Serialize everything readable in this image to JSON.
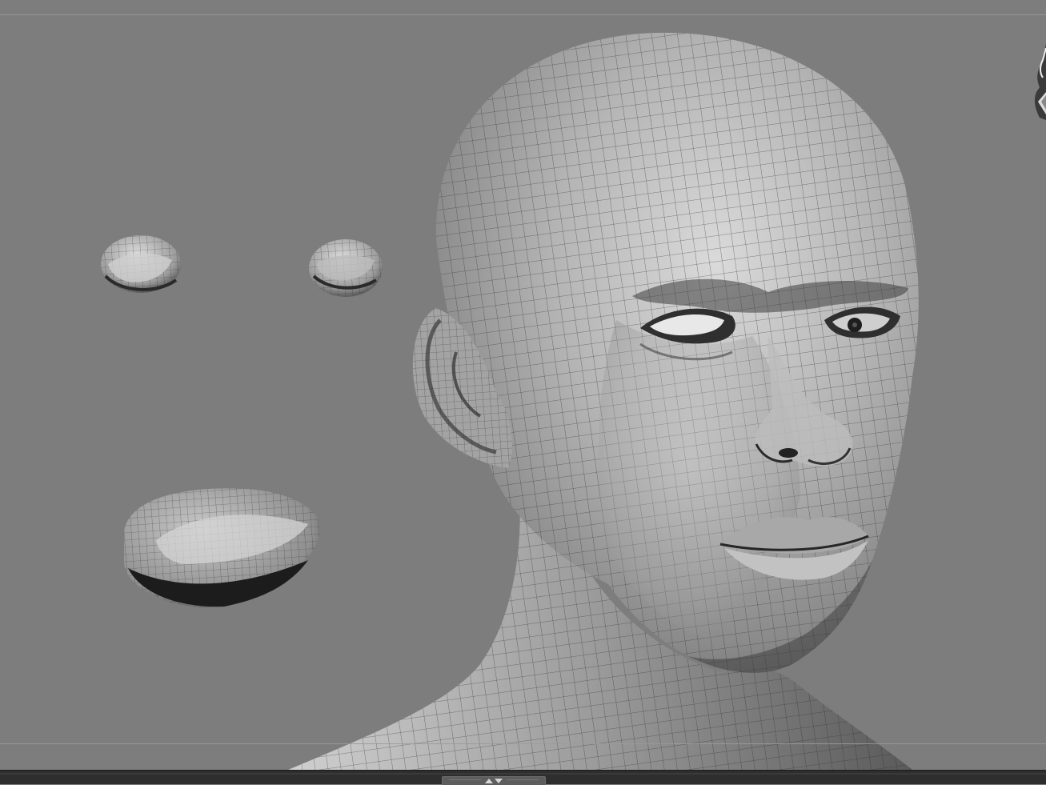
{
  "app": {
    "colors": {
      "canvas_background": "#7d7d7d",
      "mesh_light": "#d6d6d6",
      "mesh_mid": "#9a9a9a",
      "mesh_dark": "#3a3a3a",
      "wire": "#2b2b2b",
      "bottom_bar": "#2e2e2e"
    }
  },
  "viewport": {
    "objects": [
      "head-mesh",
      "left-eye-mesh",
      "right-eye-mesh",
      "mouth-mesh"
    ],
    "display": {
      "polyframe": true,
      "material": "matcap-gray"
    }
  },
  "bottom_shelf": {
    "toggle_icons": [
      "arrow-up-icon",
      "arrow-down-icon"
    ]
  }
}
